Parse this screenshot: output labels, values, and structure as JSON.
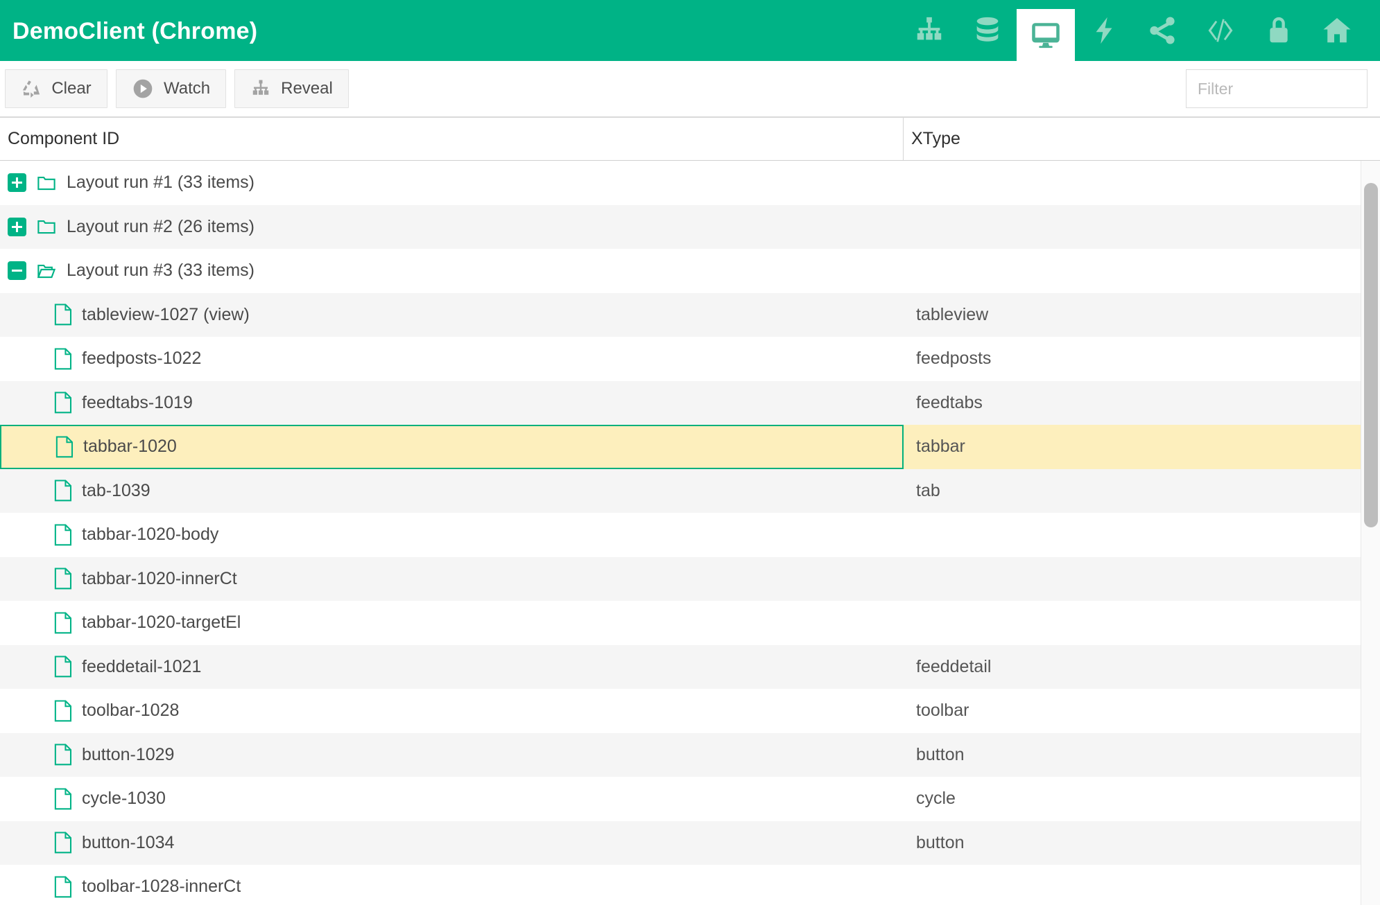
{
  "header": {
    "title": "DemoClient (Chrome)",
    "accent_color": "#00b386",
    "tabs": [
      {
        "icon": "sitemap-icon",
        "label": "Component Tree",
        "active": false
      },
      {
        "icon": "database-icon",
        "label": "Stores",
        "active": false
      },
      {
        "icon": "monitor-icon",
        "label": "Layouts",
        "active": true
      },
      {
        "icon": "lightning-icon",
        "label": "Events",
        "active": false
      },
      {
        "icon": "share-icon",
        "label": "Network",
        "active": false
      },
      {
        "icon": "code-icon",
        "label": "Console",
        "active": false
      },
      {
        "icon": "lock-icon",
        "label": "Security",
        "active": false
      },
      {
        "icon": "home-icon",
        "label": "Home",
        "active": false
      }
    ]
  },
  "toolbar": {
    "buttons": [
      {
        "icon": "recycle-icon",
        "label": "Clear"
      },
      {
        "icon": "play-circle-icon",
        "label": "Watch"
      },
      {
        "icon": "sitemap-icon",
        "label": "Reveal"
      }
    ],
    "filter": {
      "placeholder": "Filter",
      "value": "",
      "clear_icon": "close-icon"
    }
  },
  "grid": {
    "columns": [
      {
        "key": "name",
        "label": "Component ID"
      },
      {
        "key": "xtype",
        "label": "XType"
      }
    ],
    "selected_row_index": 6,
    "selection_colors": {
      "background": "#fdefbd",
      "border": "#00b07c"
    },
    "rows": [
      {
        "name": "Layout run #1 (33 items)",
        "xtype": "",
        "type": "group",
        "expanded": false,
        "icon": "folder-closed-icon",
        "twisty": "plus"
      },
      {
        "name": "Layout run #2 (26 items)",
        "xtype": "",
        "type": "group",
        "expanded": false,
        "icon": "folder-closed-icon",
        "twisty": "plus"
      },
      {
        "name": "Layout run #3 (33 items)",
        "xtype": "",
        "type": "group",
        "expanded": true,
        "icon": "folder-open-icon",
        "twisty": "minus"
      },
      {
        "name": "tableview-1027 (view)",
        "xtype": "tableview",
        "type": "leaf",
        "icon": "file-icon"
      },
      {
        "name": "feedposts-1022",
        "xtype": "feedposts",
        "type": "leaf",
        "icon": "file-icon"
      },
      {
        "name": "feedtabs-1019",
        "xtype": "feedtabs",
        "type": "leaf",
        "icon": "file-icon"
      },
      {
        "name": "tabbar-1020",
        "xtype": "tabbar",
        "type": "leaf",
        "icon": "file-icon",
        "selected": true
      },
      {
        "name": "tab-1039",
        "xtype": "tab",
        "type": "leaf",
        "icon": "file-icon"
      },
      {
        "name": "tabbar-1020-body",
        "xtype": "",
        "type": "leaf",
        "icon": "file-icon"
      },
      {
        "name": "tabbar-1020-innerCt",
        "xtype": "",
        "type": "leaf",
        "icon": "file-icon"
      },
      {
        "name": "tabbar-1020-targetEl",
        "xtype": "",
        "type": "leaf",
        "icon": "file-icon"
      },
      {
        "name": "feeddetail-1021",
        "xtype": "feeddetail",
        "type": "leaf",
        "icon": "file-icon"
      },
      {
        "name": "toolbar-1028",
        "xtype": "toolbar",
        "type": "leaf",
        "icon": "file-icon"
      },
      {
        "name": "button-1029",
        "xtype": "button",
        "type": "leaf",
        "icon": "file-icon"
      },
      {
        "name": "cycle-1030",
        "xtype": "cycle",
        "type": "leaf",
        "icon": "file-icon"
      },
      {
        "name": "button-1034",
        "xtype": "button",
        "type": "leaf",
        "icon": "file-icon"
      },
      {
        "name": "toolbar-1028-innerCt",
        "xtype": "",
        "type": "leaf",
        "icon": "file-icon"
      }
    ]
  },
  "scrollbar": {
    "orientation": "vertical",
    "thumb_position_pct": 3,
    "thumb_size_pct": 46
  }
}
